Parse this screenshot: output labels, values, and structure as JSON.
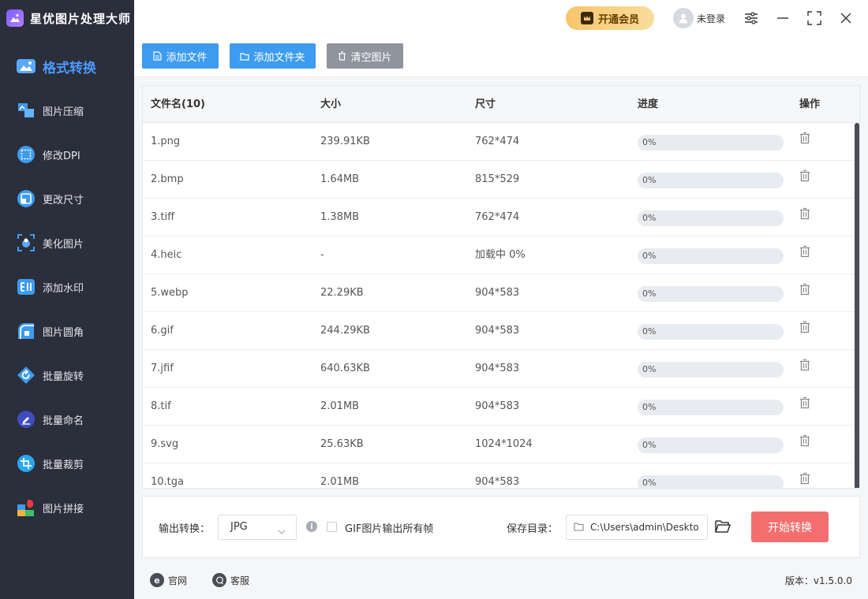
{
  "app": {
    "title": "星优图片处理大师"
  },
  "sidebar": {
    "items": [
      {
        "label": "格式转换",
        "icon": "format-convert-icon",
        "active": true
      },
      {
        "label": "图片压缩",
        "icon": "image-compress-icon"
      },
      {
        "label": "修改DPI",
        "icon": "dpi-icon"
      },
      {
        "label": "更改尺寸",
        "icon": "resize-icon"
      },
      {
        "label": "美化图片",
        "icon": "beautify-icon"
      },
      {
        "label": "添加水印",
        "icon": "watermark-icon"
      },
      {
        "label": "图片圆角",
        "icon": "round-corner-icon"
      },
      {
        "label": "批量旋转",
        "icon": "rotate-icon"
      },
      {
        "label": "批量命名",
        "icon": "rename-icon"
      },
      {
        "label": "批量裁剪",
        "icon": "crop-icon"
      },
      {
        "label": "图片拼接",
        "icon": "stitch-icon"
      }
    ]
  },
  "header": {
    "vip_label": "开通会员",
    "user_label": "未登录"
  },
  "toolbar": {
    "add_file": "添加文件",
    "add_folder": "添加文件夹",
    "clear": "清空图片"
  },
  "table": {
    "columns": [
      "文件名(10)",
      "大小",
      "尺寸",
      "进度",
      "操作"
    ],
    "rows": [
      {
        "name": "1.png",
        "size": "239.91KB",
        "dim": "762*474",
        "progress": "0%",
        "progress_value": 0
      },
      {
        "name": "2.bmp",
        "size": "1.64MB",
        "dim": "815*529",
        "progress": "0%",
        "progress_value": 0
      },
      {
        "name": "3.tiff",
        "size": "1.38MB",
        "dim": "762*474",
        "progress": "0%",
        "progress_value": 0
      },
      {
        "name": "4.heic",
        "size": "-",
        "dim": "加载中 0%",
        "progress": "0%",
        "progress_value": 0
      },
      {
        "name": "5.webp",
        "size": "22.29KB",
        "dim": "904*583",
        "progress": "0%",
        "progress_value": 0
      },
      {
        "name": "6.gif",
        "size": "244.29KB",
        "dim": "904*583",
        "progress": "0%",
        "progress_value": 0
      },
      {
        "name": "7.jfif",
        "size": "640.63KB",
        "dim": "904*583",
        "progress": "0%",
        "progress_value": 0
      },
      {
        "name": "8.tif",
        "size": "2.01MB",
        "dim": "904*583",
        "progress": "0%",
        "progress_value": 0
      },
      {
        "name": "9.svg",
        "size": "25.63KB",
        "dim": "1024*1024",
        "progress": "0%",
        "progress_value": 0
      },
      {
        "name": "10.tga",
        "size": "2.01MB",
        "dim": "904*583",
        "progress": "0%",
        "progress_value": 0
      }
    ]
  },
  "options": {
    "output_label": "输出转换：",
    "output_format": "JPG",
    "gif_label": "GIF图片输出所有帧",
    "save_label": "保存目录：",
    "save_path": "C:\\Users\\admin\\Deskto",
    "start_label": "开始转换"
  },
  "footer": {
    "website": "官网",
    "support": "客服",
    "version": "版本：v1.5.0.0"
  },
  "colors": {
    "accent": "#3d9cf0",
    "start": "#f36f6f",
    "sidebar": "#2b2e3b"
  }
}
